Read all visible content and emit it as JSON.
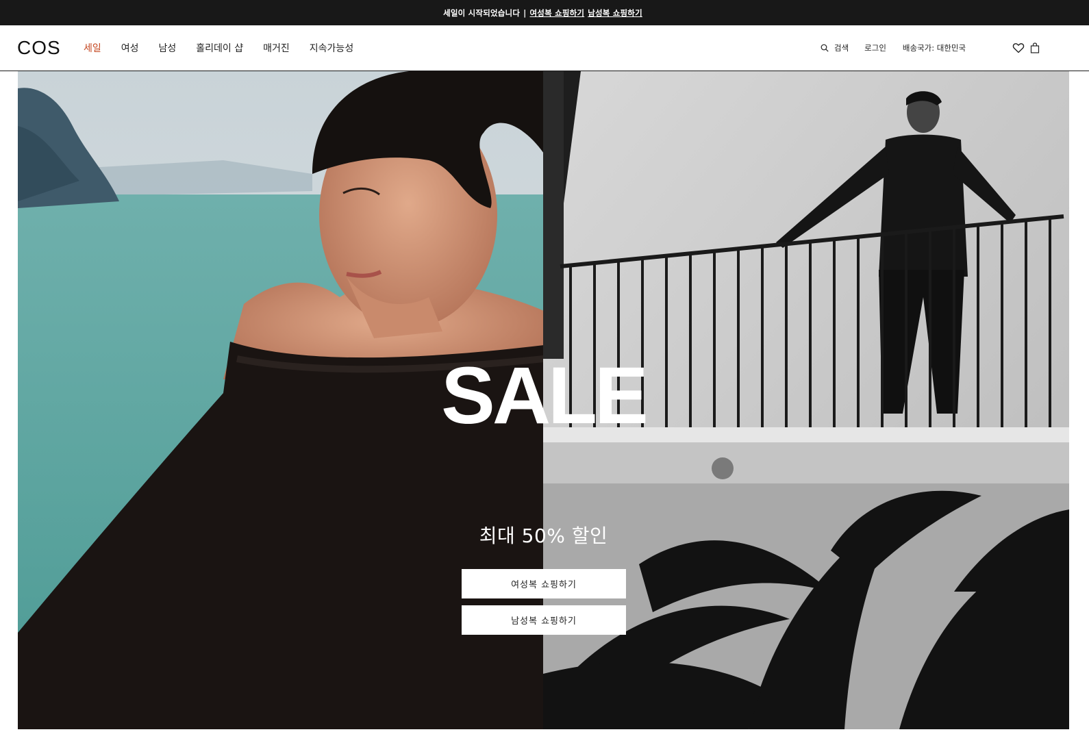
{
  "announcement": {
    "text": "세일이 시작되었습니다",
    "separator": "|",
    "link_women": "여성복 쇼핑하기",
    "link_men": "남성복 쇼핑하기"
  },
  "header": {
    "logo": "COS",
    "nav": [
      {
        "label": "세일",
        "active": true
      },
      {
        "label": "여성"
      },
      {
        "label": "남성"
      },
      {
        "label": "홀리데이 샵"
      },
      {
        "label": "매거진"
      },
      {
        "label": "지속가능성"
      }
    ],
    "search_label": "검색",
    "login_label": "로그인",
    "country_label": "배송국가: 대한민국",
    "icons": [
      "search-icon",
      "heart-icon",
      "shopping-bag-icon"
    ],
    "accent_color": "#c4451e"
  },
  "hero": {
    "title": "SALE",
    "subtitle": "최대 50% 할인",
    "cta_women": "여성복 쇼핑하기",
    "cta_men": "남성복 쇼핑하기"
  }
}
